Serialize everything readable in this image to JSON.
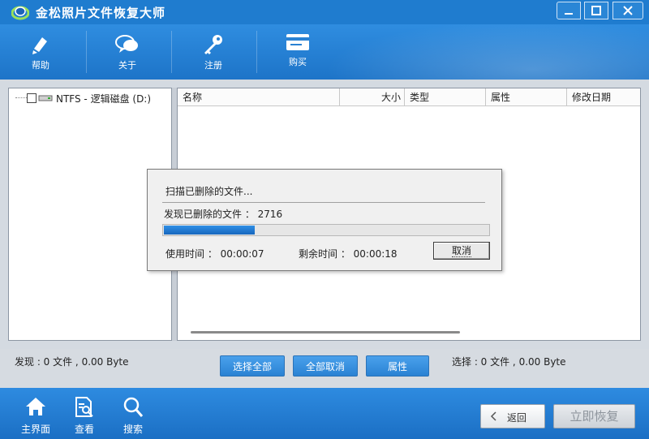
{
  "app": {
    "title": "金松照片文件恢复大师"
  },
  "toolbar": {
    "items": [
      {
        "label": "帮助",
        "icon": "help-icon"
      },
      {
        "label": "关于",
        "icon": "about-icon"
      },
      {
        "label": "注册",
        "icon": "key-icon"
      },
      {
        "label": "购买",
        "icon": "card-icon"
      }
    ]
  },
  "tree": {
    "drive_label": "NTFS - 逻辑磁盘 (D:)"
  },
  "file_list": {
    "columns": [
      "名称",
      "大小",
      "类型",
      "属性",
      "修改日期"
    ]
  },
  "status": {
    "found": "发现 : 0 文件 , 0.00 Byte",
    "selected": "选择 : 0 文件 , 0.00 Byte"
  },
  "actions": {
    "select_all": "选择全部",
    "deselect_all": "全部取消",
    "properties": "属性"
  },
  "bottom_nav": {
    "items": [
      {
        "label": "主界面",
        "icon": "home-icon"
      },
      {
        "label": "查看",
        "icon": "view-icon"
      },
      {
        "label": "搜索",
        "icon": "search-icon"
      }
    ],
    "back": "返回",
    "recover": "立即恢复"
  },
  "scan_dialog": {
    "scanning": "扫描已删除的文件...",
    "found": "发现已删除的文件 ： 2716",
    "progress": 0.28,
    "elapsed": "使用时间 ： 00:00:07",
    "remaining": "剩余时间 ： 00:00:18",
    "cancel": "取消"
  },
  "colors": {
    "accent": "#1f7ccf",
    "progress": "#1e78d2"
  }
}
